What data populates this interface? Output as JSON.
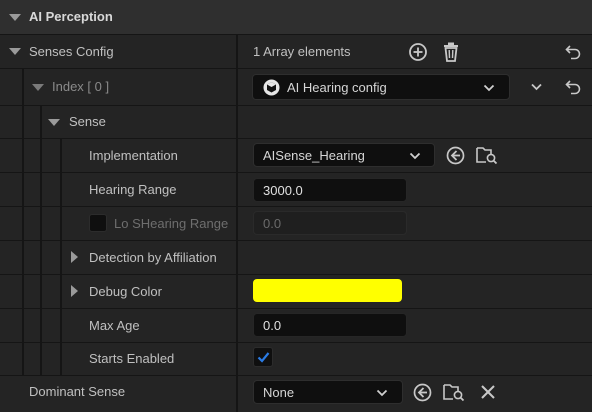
{
  "header": {
    "title": "AI Perception"
  },
  "senses_config": {
    "label": "Senses Config",
    "count_text": "1 Array elements"
  },
  "index_row": {
    "label": "Index [ 0 ]",
    "value": "AI Hearing config"
  },
  "sense": {
    "label": "Sense"
  },
  "implementation": {
    "label": "Implementation",
    "value": "AISense_Hearing"
  },
  "hearing_range": {
    "label": "Hearing Range",
    "value": "3000.0"
  },
  "lo_s_hearing_range": {
    "label": "Lo SHearing Range",
    "value": "0.0",
    "checked": false
  },
  "detection_by_affiliation": {
    "label": "Detection by Affiliation"
  },
  "debug_color": {
    "label": "Debug Color",
    "color": "#ffff00"
  },
  "max_age": {
    "label": "Max Age",
    "value": "0.0"
  },
  "starts_enabled": {
    "label": "Starts Enabled",
    "checked": true
  },
  "dominant_sense": {
    "label": "Dominant Sense",
    "value": "None"
  },
  "colors": {
    "background": "#151515",
    "panel": "#242424",
    "header": "#2f2f2f",
    "checkbox_accent": "#1e6fd9",
    "debug_swatch": "#ffff00"
  }
}
